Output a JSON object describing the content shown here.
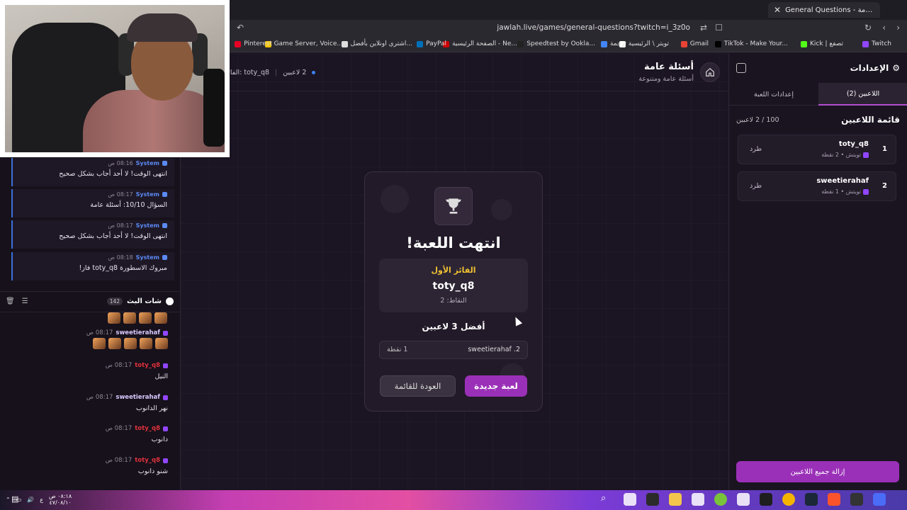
{
  "browser": {
    "tab_title": "General Questions - أسئلة عامة",
    "url": "jawlah.live/games/general-questions?twitch=i_3z0o",
    "bookmarks": [
      "Twitch",
      "Kick | تصفع",
      "TikTok - Make Your...",
      "Gmail",
      "تويتر \\ الرئيسية",
      "ترجمة",
      "Speedtest by Ookla...",
      "الصفحة الرئيسية - Ne...",
      "PayPal",
      "اشتري اونلاين بأفضل...",
      "Game Server, Voice...",
      "Pinterest"
    ]
  },
  "header": {
    "title": "أسئلة عامة",
    "subtitle": "أسئلة عامة ومتنوعة",
    "players_count": "2 لاعبين",
    "winner_short": "toty_q8 :الفائز"
  },
  "game_over": {
    "title": "انتهت اللعبة!",
    "winner_label": "الفائز الأول",
    "winner_name": "toty_q8",
    "winner_points": "النقاط: 2",
    "top_heading": "أفضل 3 لاعبين",
    "ranking": [
      {
        "name": "2. sweetierahaf",
        "points": "1 نقطة"
      }
    ],
    "new_game": "لعبة جديدة",
    "back_to_list": "العودة للقائمة"
  },
  "settings": {
    "title": "الإعدادات",
    "tabs": {
      "players": "اللاعبين (2)",
      "game_settings": "إعدادات اللعبة"
    },
    "players_heading": "قائمة اللاعبين",
    "players_count": "100 / 2 لاعبين",
    "players": [
      {
        "rank": "1",
        "name": "toty_q8",
        "meta": "تويتش • 2 نقطة",
        "kick": "طرد"
      },
      {
        "rank": "2",
        "name": "sweetierahaf",
        "meta": "تويتش • 1 نقطة",
        "kick": "طرد"
      }
    ],
    "remove_all": "إزالة جميع اللاعبين"
  },
  "system_chat": [
    {
      "user": "System",
      "time": "08:16 ص",
      "text": "انتهى الوقت! لا أحد أجاب بشكل صحيح"
    },
    {
      "user": "System",
      "time": "08:17 ص",
      "text": "السؤال 10/10: أسئلة عامة"
    },
    {
      "user": "System",
      "time": "08:17 ص",
      "text": "انتهى الوقت! لا أحد أجاب بشكل صحيح"
    },
    {
      "user": "System",
      "time": "08:18 ص",
      "text": "مبروك الاسطورة toty_q8 فاز!"
    }
  ],
  "stream_chat": {
    "title": "شات البث",
    "count": "142",
    "messages": [
      {
        "user": "sweetierahaf",
        "color": "#d9c9ff",
        "time": "08:17 ص",
        "text": ""
      },
      {
        "user": "toty_q8",
        "color": "#e0313b",
        "time": "08:17 ص",
        "text": "النيل"
      },
      {
        "user": "sweetierahaf",
        "color": "#d9c9ff",
        "time": "08:17 ص",
        "text": "نهر الدانوب"
      },
      {
        "user": "toty_q8",
        "color": "#e0313b",
        "time": "08:17 ص",
        "text": "دانوب"
      },
      {
        "user": "toty_q8",
        "color": "#e0313b",
        "time": "08:17 ص",
        "text": "شنو دانوب"
      }
    ]
  },
  "taskbar": {
    "time": "٠٨:١٨ ص",
    "date": "٤٧/٠٨/١٠",
    "lang": "ع"
  },
  "colors": {
    "accent": "#9b30b8",
    "gold": "#f1c232",
    "system_blue": "#5b8af5"
  }
}
